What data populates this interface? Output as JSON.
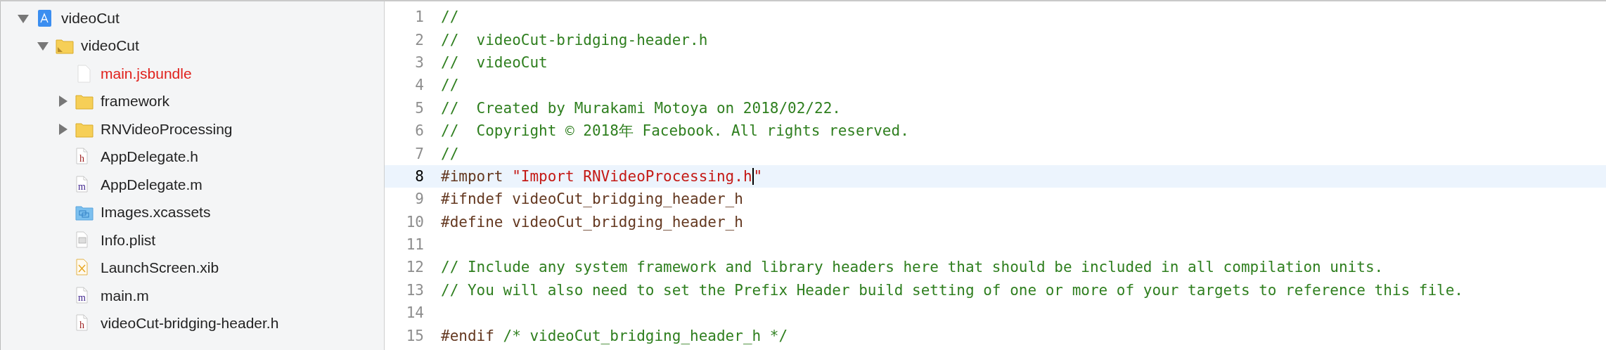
{
  "navigator": {
    "items": [
      {
        "name": "videoCut",
        "kind": "project",
        "expanded": true,
        "missing": false,
        "children": [
          {
            "name": "videoCut",
            "kind": "group",
            "expanded": true,
            "missing": false,
            "children": [
              {
                "name": "main.jsbundle",
                "kind": "blank",
                "missing": true
              },
              {
                "name": "framework",
                "kind": "folder",
                "expanded": false,
                "missing": false
              },
              {
                "name": "RNVideoProcessing",
                "kind": "folder",
                "expanded": false,
                "missing": false
              },
              {
                "name": "AppDelegate.h",
                "kind": "header",
                "badge": "h",
                "missing": false
              },
              {
                "name": "AppDelegate.m",
                "kind": "impl",
                "badge": "m",
                "missing": false
              },
              {
                "name": "Images.xcassets",
                "kind": "assets",
                "missing": false
              },
              {
                "name": "Info.plist",
                "kind": "plist",
                "missing": false
              },
              {
                "name": "LaunchScreen.xib",
                "kind": "xib",
                "missing": false
              },
              {
                "name": "main.m",
                "kind": "impl",
                "badge": "m",
                "missing": false
              },
              {
                "name": "videoCut-bridging-header.h",
                "kind": "header",
                "badge": "h",
                "missing": false
              }
            ]
          }
        ]
      }
    ]
  },
  "editor": {
    "lines": [
      {
        "number": "1",
        "current": false,
        "segments": [
          {
            "kind": "comment",
            "text": "//"
          }
        ]
      },
      {
        "number": "2",
        "current": false,
        "segments": [
          {
            "kind": "comment",
            "text": "//  videoCut-bridging-header.h"
          }
        ]
      },
      {
        "number": "3",
        "current": false,
        "segments": [
          {
            "kind": "comment",
            "text": "//  videoCut"
          }
        ]
      },
      {
        "number": "4",
        "current": false,
        "segments": [
          {
            "kind": "comment",
            "text": "//"
          }
        ]
      },
      {
        "number": "5",
        "current": false,
        "segments": [
          {
            "kind": "comment",
            "text": "//  Created by Murakami Motoya on 2018/02/22."
          }
        ]
      },
      {
        "number": "6",
        "current": false,
        "segments": [
          {
            "kind": "comment",
            "text": "//  Copyright © 2018年 Facebook. All rights reserved."
          }
        ]
      },
      {
        "number": "7",
        "current": false,
        "segments": [
          {
            "kind": "comment",
            "text": "//"
          }
        ]
      },
      {
        "number": "8",
        "current": true,
        "segments": [
          {
            "kind": "preprocessor",
            "text": "#import "
          },
          {
            "kind": "string",
            "text": "\"Import RNVideoProcessing.h"
          },
          {
            "kind": "cursor"
          },
          {
            "kind": "string",
            "text": "\""
          }
        ]
      },
      {
        "number": "9",
        "current": false,
        "segments": [
          {
            "kind": "preprocessor",
            "text": "#ifndef videoCut_bridging_header_h"
          }
        ]
      },
      {
        "number": "10",
        "current": false,
        "segments": [
          {
            "kind": "preprocessor",
            "text": "#define videoCut_bridging_header_h"
          }
        ]
      },
      {
        "number": "11",
        "current": false
      },
      {
        "number": "12",
        "current": false,
        "segments": [
          {
            "kind": "comment",
            "text": "// Include any system framework and library headers here that should be included in all compilation units."
          }
        ]
      },
      {
        "number": "13",
        "current": false,
        "segments": [
          {
            "kind": "comment",
            "text": "// You will also need to set the Prefix Header build setting of one or more of your targets to reference this file."
          }
        ]
      },
      {
        "number": "14",
        "current": false
      },
      {
        "number": "15",
        "current": false,
        "segments": [
          {
            "kind": "preprocessor",
            "text": "#endif "
          },
          {
            "kind": "comment",
            "text": "/* videoCut_bridging_header_h */"
          }
        ]
      }
    ]
  }
}
